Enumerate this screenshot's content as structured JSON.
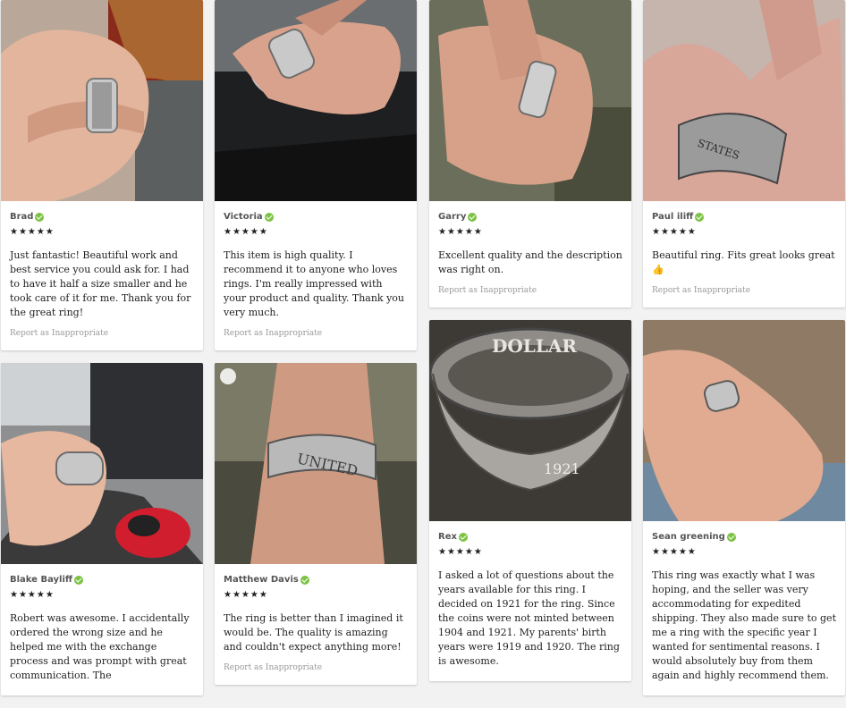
{
  "report_label": "Report as Inappropriate",
  "stars": "★★★★★",
  "reviews": [
    {
      "author": "Brad",
      "text": "Just fantastic! Beautiful work and best service you could ask for. I had to have it half a size smaller and he took care of it for me. Thank you for the great ring!"
    },
    {
      "author": "Victoria",
      "text": "This item is high quality. I recommend it to anyone who loves rings. I'm really impressed with your product and quality. Thank you very much."
    },
    {
      "author": "Garry",
      "text": "Excellent quality and the description was right on."
    },
    {
      "author": "Paul iliff",
      "text": "Beautiful ring. Fits great looks great 👍"
    },
    {
      "author": "Blake Bayliff",
      "text": "Robert was awesome. I accidentally ordered the wrong size and he helped me with the exchange process and was prompt with great communication. The"
    },
    {
      "author": "Matthew Davis",
      "text": "The ring is better than I imagined it would be. The quality is amazing and couldn't expect anything more!"
    },
    {
      "author": "Rex",
      "text": "I asked a lot of questions about the years available for this ring. I decided on 1921 for the ring. Since the coins were not minted between 1904 and 1921. My parents' birth years were 1919 and 1920. The ring is awesome."
    },
    {
      "author": "Sean greening",
      "text": "This ring was exactly what I was hoping, and the seller was very accommodating for expedited shipping. They also made sure to get me a ring with the specific year I wanted for sentimental reasons. I would absolutely buy from them again and highly recommend them."
    }
  ],
  "photo_text": {
    "dollar": "DOLLAR",
    "year": "1921",
    "united": "UNITED",
    "states": "STATES"
  },
  "colors": {
    "verified": "#7cc243",
    "report": "#999999",
    "card_bg": "#ffffff",
    "page_bg": "#f2f2f2"
  }
}
